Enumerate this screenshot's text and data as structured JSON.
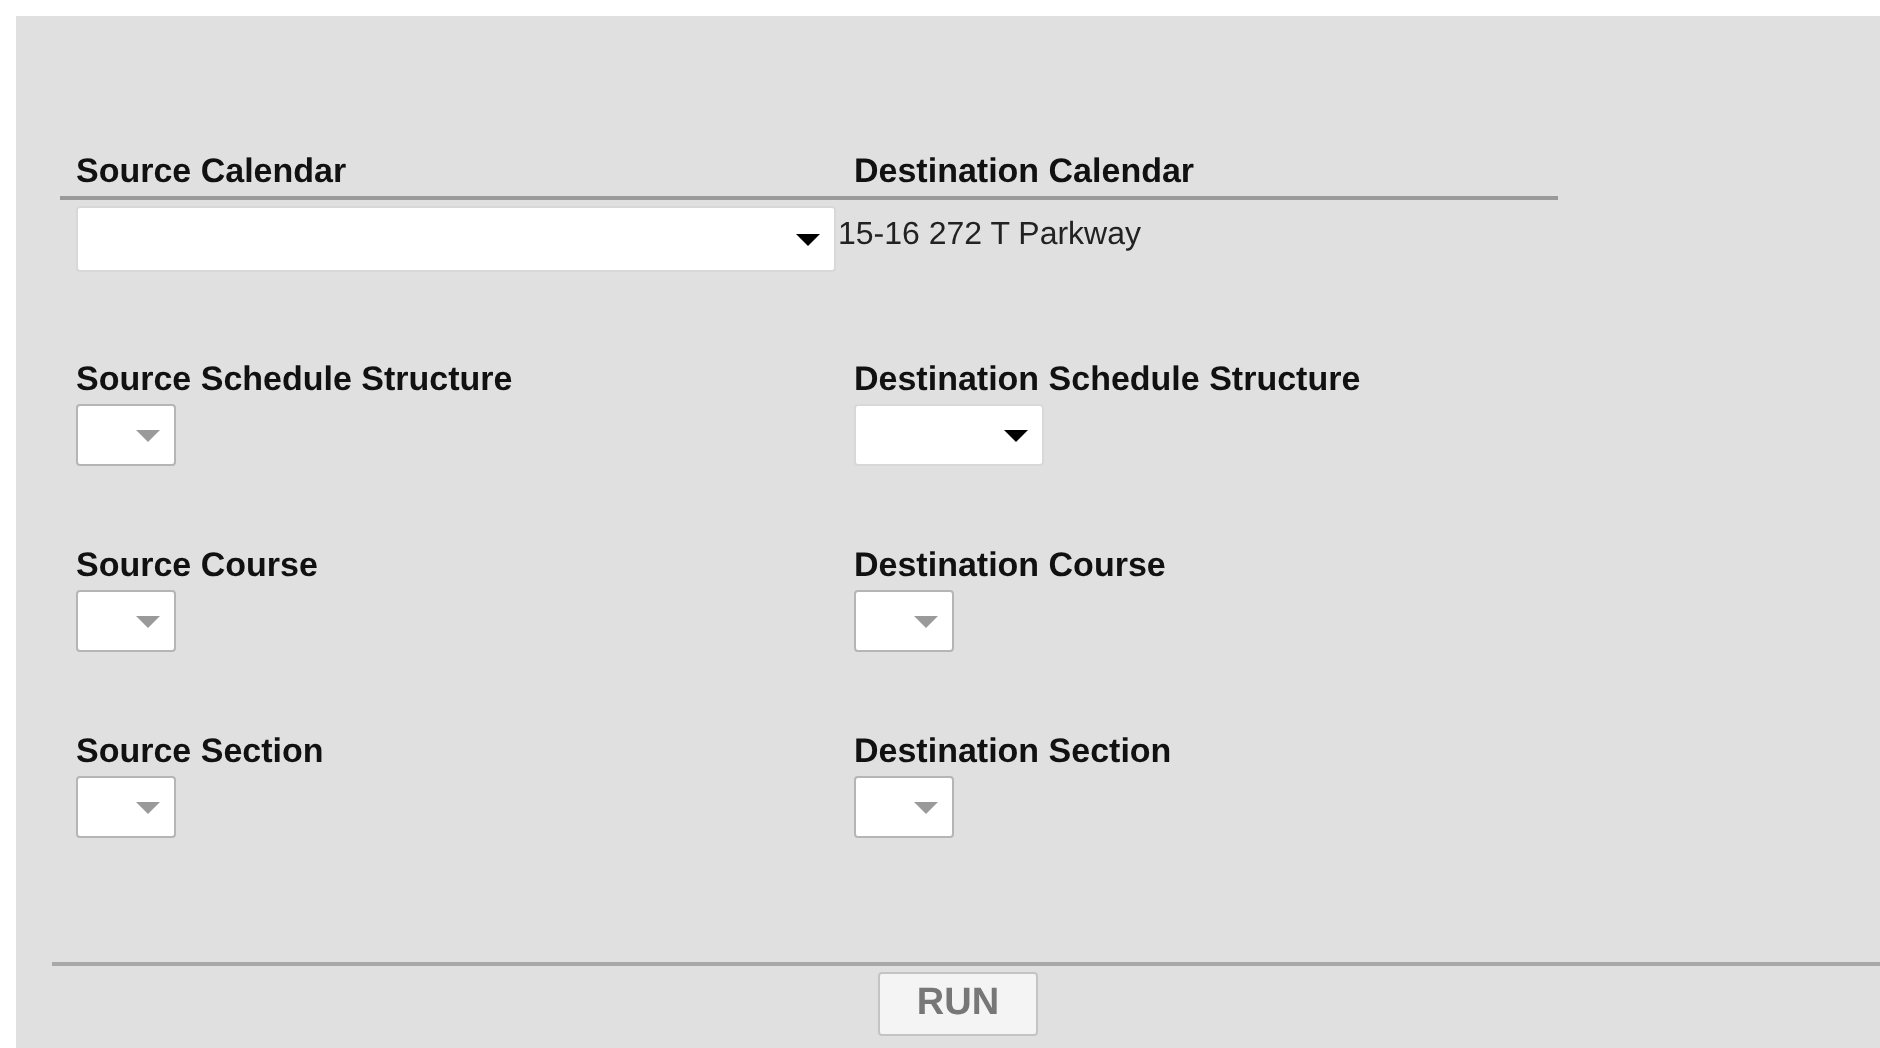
{
  "rows": [
    {
      "source": {
        "label": "Source Calendar",
        "control": {
          "kind": "select",
          "disabled": false
        }
      },
      "destination": {
        "label": "Destination Calendar",
        "control": {
          "kind": "text",
          "value": "15-16 272 T Parkway"
        }
      }
    },
    {
      "source": {
        "label": "Source Schedule Structure",
        "control": {
          "kind": "select",
          "disabled": true
        }
      },
      "destination": {
        "label": "Destination Schedule Structure",
        "control": {
          "kind": "select",
          "disabled": false
        }
      }
    },
    {
      "source": {
        "label": "Source Course",
        "control": {
          "kind": "select",
          "disabled": true
        }
      },
      "destination": {
        "label": "Destination Course",
        "control": {
          "kind": "select",
          "disabled": true
        }
      }
    },
    {
      "source": {
        "label": "Source Section",
        "control": {
          "kind": "select",
          "disabled": true
        }
      },
      "destination": {
        "label": "Destination Section",
        "control": {
          "kind": "select",
          "disabled": true
        }
      }
    }
  ],
  "run_button": {
    "label": "RUN"
  }
}
